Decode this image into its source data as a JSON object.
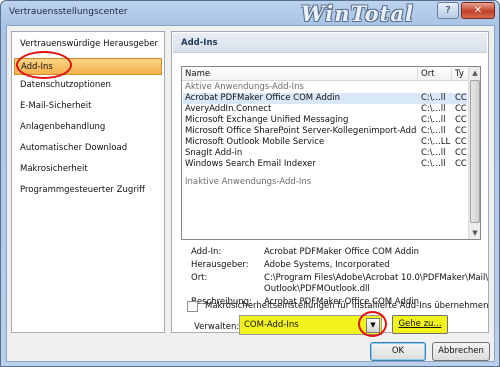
{
  "window": {
    "title": "Vertrauensstellungscenter",
    "watermark": "WinTotal"
  },
  "titlebar_buttons": {
    "help": "?",
    "close": "✕"
  },
  "sidebar": {
    "items": [
      {
        "label": "Vertrauenswürdige Herausgeber"
      },
      {
        "label": "Add-Ins"
      },
      {
        "label": "Datenschutzoptionen"
      },
      {
        "label": "E-Mail-Sicherheit"
      },
      {
        "label": "Anlagenbehandlung"
      },
      {
        "label": "Automatischer Download"
      },
      {
        "label": "Makrosicherheit"
      },
      {
        "label": "Programmgesteuerter Zugriff"
      }
    ],
    "selected_label": "Add-Ins"
  },
  "main": {
    "section_title": "Add-Ins",
    "list": {
      "columns": {
        "name": "Name",
        "location": "Ort",
        "type": "Ty"
      },
      "groups": {
        "active": "Aktive Anwendungs-Add-Ins",
        "inactive": "Inaktive Anwendungs-Add-Ins"
      },
      "rows": [
        {
          "name": "Acrobat PDFMaker Office COM Addin",
          "location": "C:\\...ll",
          "type": "CC"
        },
        {
          "name": "AveryAddIn.Connect",
          "location": "C:\\...ll",
          "type": "CC"
        },
        {
          "name": "Microsoft Exchange Unified Messaging",
          "location": "C:\\...ll",
          "type": "CC"
        },
        {
          "name": "Microsoft Office SharePoint Server-Kollegenimport-Add-In",
          "location": "C:\\...ll",
          "type": "CC"
        },
        {
          "name": "Microsoft Outlook Mobile Service",
          "location": "C:\\...LL",
          "type": "CC"
        },
        {
          "name": "SnagIt Add-in",
          "location": "C:\\...ll",
          "type": "CC"
        },
        {
          "name": "Windows Search Email Indexer",
          "location": "C:\\...ll",
          "type": "CC"
        }
      ]
    },
    "details": {
      "addin_label": "Add-In:",
      "addin_value": "Acrobat PDFMaker Office COM Addin",
      "publisher_label": "Herausgeber:",
      "publisher_value": "Adobe Systems, Incorporated",
      "location_label": "Ort:",
      "location_value_1": "C:\\Program Files\\Adobe\\Acrobat 10.0\\PDFMaker\\Mail\\",
      "location_value_2": "Outlook\\PDFMOutlook.dll",
      "description_label": "Beschreibung:",
      "description_value": "Acrobat PDFMaker Office COM Addin"
    },
    "macro_checkbox_label": "Makrosicherheitseinstellungen für installierte Add-Ins übernehmen",
    "macro_checkbox_checked": false,
    "manage_label": "Verwalten:",
    "manage_value": "COM-Add-Ins",
    "go_button": "Gehe zu..."
  },
  "footer": {
    "ok": "OK",
    "cancel": "Abbrechen"
  },
  "icons": {
    "dropdown": "chevron-down-icon",
    "scroll_up": "arrow-up-icon",
    "scroll_down": "arrow-down-icon"
  },
  "colors": {
    "highlight": "#f2f31c",
    "annotation": "#e01010",
    "selection": "#f5b04c"
  }
}
